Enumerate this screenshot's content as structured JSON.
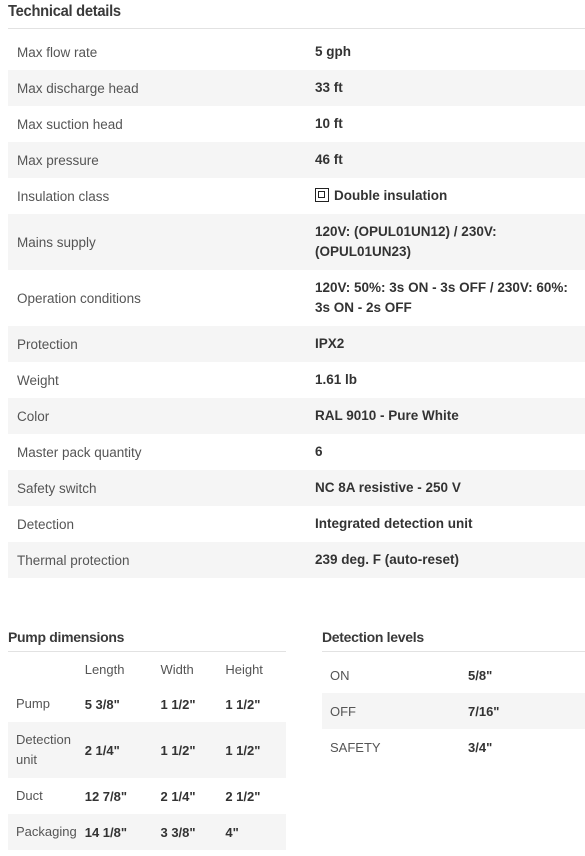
{
  "technical_details": {
    "title": "Technical details",
    "rows": [
      {
        "label": "Max flow rate",
        "value": "5 gph"
      },
      {
        "label": "Max discharge head",
        "value": "33 ft"
      },
      {
        "label": "Max suction head",
        "value": "10 ft"
      },
      {
        "label": "Max pressure",
        "value": "46 ft"
      },
      {
        "label": "Insulation class",
        "value": "Double insulation",
        "icon": "double-insulation-icon"
      },
      {
        "label": "Mains supply",
        "value": "120V: (OPUL01UN12) / 230V: (OPUL01UN23)"
      },
      {
        "label": "Operation conditions",
        "value": "120V: 50%: 3s ON - 3s OFF / 230V: 60%: 3s ON - 2s OFF"
      },
      {
        "label": "Protection",
        "value": "IPX2"
      },
      {
        "label": "Weight",
        "value": "1.61 lb"
      },
      {
        "label": "Color",
        "value": "RAL 9010 - Pure White"
      },
      {
        "label": "Master pack quantity",
        "value": "6"
      },
      {
        "label": "Safety switch",
        "value": "NC 8A resistive - 250 V"
      },
      {
        "label": "Detection",
        "value": "Integrated detection unit"
      },
      {
        "label": "Thermal protection",
        "value": "239 deg. F (auto-reset)"
      }
    ]
  },
  "pump_dimensions": {
    "title": "Pump dimensions",
    "columns": [
      "",
      "Length",
      "Width",
      "Height"
    ],
    "rows": [
      {
        "label": "Pump",
        "values": [
          "5 3/8\"",
          "1 1/2\"",
          "1 1/2\""
        ]
      },
      {
        "label": "Detection unit",
        "values": [
          "2 1/4\"",
          "1 1/2\"",
          "1 1/2\""
        ]
      },
      {
        "label": "Duct",
        "values": [
          "12 7/8\"",
          "2 1/4\"",
          "2 1/2\""
        ]
      },
      {
        "label": "Packaging",
        "values": [
          "14 1/8\"",
          "3 3/8\"",
          "4\""
        ]
      }
    ]
  },
  "detection_levels": {
    "title": "Detection levels",
    "rows": [
      {
        "label": "ON",
        "value": "5/8\""
      },
      {
        "label": "OFF",
        "value": "7/16\""
      },
      {
        "label": "SAFETY",
        "value": "3/4\""
      }
    ]
  }
}
